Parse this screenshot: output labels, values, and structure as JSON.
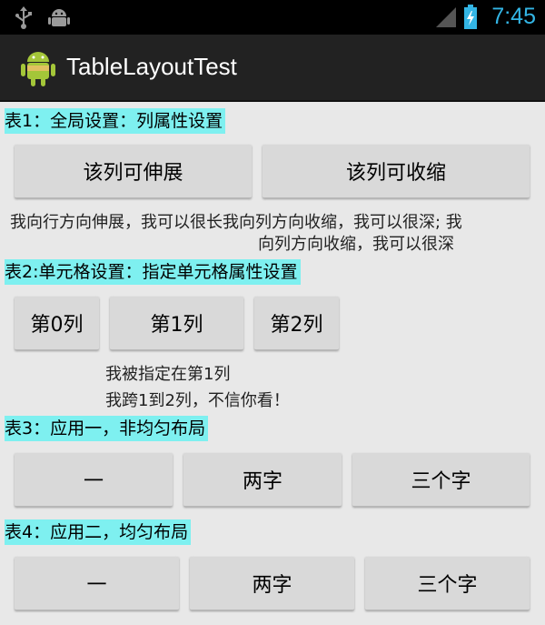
{
  "status_bar": {
    "time": "7:45",
    "icons": [
      "usb-icon",
      "android-debug-icon",
      "signal-icon",
      "battery-icon"
    ]
  },
  "action_bar": {
    "title": "TableLayoutTest",
    "icon": "android-app-icon"
  },
  "table1": {
    "label": "表1：全局设置：列属性设置",
    "buttons": [
      "该列可伸展",
      "该列可收缩"
    ],
    "text_line1": "我向行方向伸展，我可以很长我向列方向收缩，我可以很深; 我",
    "text_line2": "向列方向收缩，我可以很深"
  },
  "table2": {
    "label": "表2:单元格设置：指定单元格属性设置",
    "buttons": [
      "第0列",
      "第1列",
      "第2列"
    ],
    "text_line1": "我被指定在第1列",
    "text_line2": "我跨1到2列，不信你看！"
  },
  "table3": {
    "label": "表3：应用一，非均匀布局",
    "buttons": [
      "一",
      "两字",
      "三个字"
    ]
  },
  "table4": {
    "label": "表4：应用二，均匀布局",
    "buttons": [
      "一",
      "两字",
      "三个字"
    ]
  },
  "colors": {
    "label_bg": "#7ef0f0",
    "clock": "#33b5e5",
    "action_bar": "#222222",
    "button": "#d9d9d9"
  }
}
